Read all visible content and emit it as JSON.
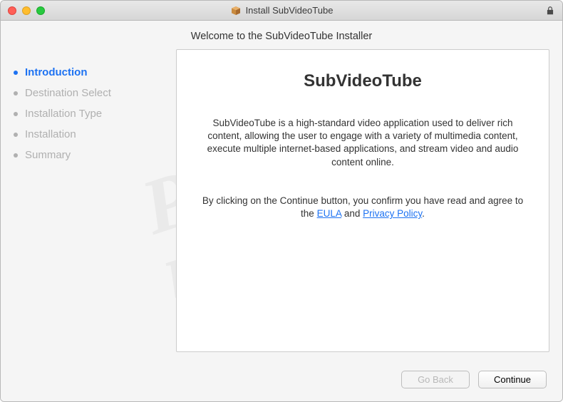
{
  "titlebar": {
    "title": "Install SubVideoTube"
  },
  "welcome": "Welcome to the SubVideoTube Installer",
  "sidebar": {
    "steps": [
      {
        "label": "Introduction",
        "active": true
      },
      {
        "label": "Destination Select",
        "active": false
      },
      {
        "label": "Installation Type",
        "active": false
      },
      {
        "label": "Installation",
        "active": false
      },
      {
        "label": "Summary",
        "active": false
      }
    ]
  },
  "content": {
    "title": "SubVideoTube",
    "description": "SubVideoTube is a high-standard video application used to deliver rich content, allowing the user to engage with a variety of multimedia content, execute multiple internet-based applications, and stream video and audio content online.",
    "agree_prefix": "By clicking on the Continue button, you confirm you have read and agree to the ",
    "eula": "EULA",
    "and": " and ",
    "privacy": "Privacy Policy",
    "agree_suffix": "."
  },
  "footer": {
    "go_back": "Go Back",
    "continue": "Continue"
  },
  "watermark": {
    "line1": "PC",
    "line2": "risk.com"
  }
}
